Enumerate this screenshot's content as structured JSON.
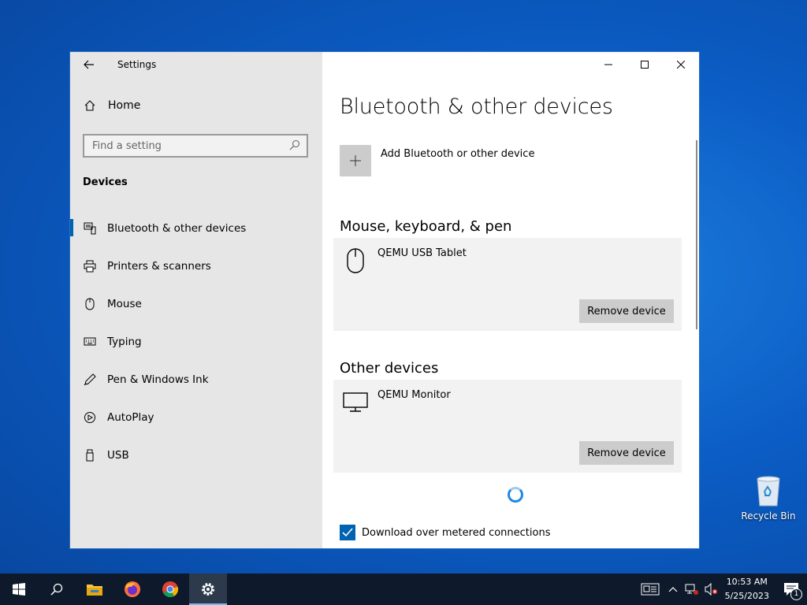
{
  "desktop": {
    "recycle_bin_label": "Recycle Bin"
  },
  "window": {
    "app_title": "Settings",
    "nav": {
      "home_label": "Home",
      "search_placeholder": "Find a setting",
      "section_title": "Devices",
      "items": [
        {
          "label": "Bluetooth & other devices",
          "icon": "bluetooth-devices-icon",
          "selected": true
        },
        {
          "label": "Printers & scanners",
          "icon": "printer-icon",
          "selected": false
        },
        {
          "label": "Mouse",
          "icon": "mouse-icon",
          "selected": false
        },
        {
          "label": "Typing",
          "icon": "keyboard-icon",
          "selected": false
        },
        {
          "label": "Pen & Windows Ink",
          "icon": "pen-icon",
          "selected": false
        },
        {
          "label": "AutoPlay",
          "icon": "autoplay-icon",
          "selected": false
        },
        {
          "label": "USB",
          "icon": "usb-icon",
          "selected": false
        }
      ]
    },
    "content": {
      "page_title": "Bluetooth & other devices",
      "add_device_label": "Add Bluetooth or other device",
      "groups": [
        {
          "title": "Mouse, keyboard, & pen",
          "device": "QEMU USB Tablet",
          "icon": "mouse-icon",
          "button": "Remove device"
        },
        {
          "title": "Other devices",
          "device": "QEMU Monitor",
          "icon": "monitor-icon",
          "button": "Remove device"
        }
      ],
      "metered_label": "Download over metered connections",
      "metered_checked": true
    }
  },
  "taskbar": {
    "time": "10:53 AM",
    "date": "5/25/2023",
    "notification_count": "1"
  },
  "colors": {
    "accent": "#0063b1",
    "sidebar_bg": "#e6e6e6",
    "card_bg": "#f2f2f2",
    "taskbar_bg": "#0e1a2b"
  }
}
